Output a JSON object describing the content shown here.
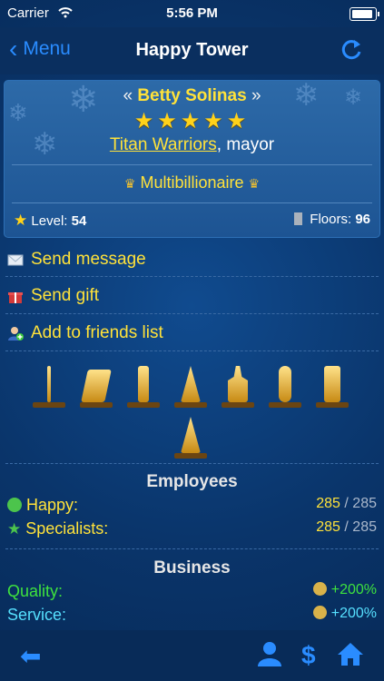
{
  "status_bar": {
    "carrier": "Carrier",
    "time": "5:56 PM"
  },
  "nav": {
    "back_label": "Menu",
    "title": "Happy Tower"
  },
  "profile": {
    "quote_open": "«",
    "name": "Betty Solinas",
    "quote_close": "»",
    "stars": "★★★★★",
    "stars_count": 5,
    "guild": "Titan Warriors",
    "role": ", mayor",
    "rank": "Multibillionaire",
    "level_label": "Level:",
    "level_value": "54",
    "floors_label": "Floors:",
    "floors_value": "96"
  },
  "actions": [
    {
      "label": "Send message",
      "icon": "envelope-icon"
    },
    {
      "label": "Send gift",
      "icon": "gift-icon"
    },
    {
      "label": "Add to friends list",
      "icon": "add-friend-icon"
    }
  ],
  "employees": {
    "title": "Employees",
    "happy_label": "Happy:",
    "happy_value": "285",
    "happy_total": "285",
    "specialists_label": "Specialists:",
    "specialists_value": "285",
    "specialists_total": "285",
    "separator": "/"
  },
  "business": {
    "title": "Business",
    "quality_label": "Quality:",
    "quality_value": "+200%",
    "service_label": "Service:",
    "service_value": "+200%"
  },
  "colors": {
    "accent": "#2a8cff",
    "gold": "#ffe23a",
    "green": "#3ee23e",
    "cyan": "#56e0ff"
  }
}
